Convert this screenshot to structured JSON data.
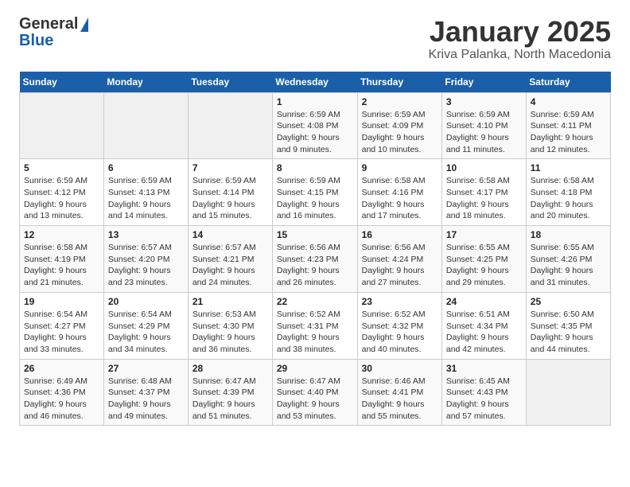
{
  "header": {
    "logo_general": "General",
    "logo_blue": "Blue",
    "month_title": "January 2025",
    "location": "Kriva Palanka, North Macedonia"
  },
  "weekdays": [
    "Sunday",
    "Monday",
    "Tuesday",
    "Wednesday",
    "Thursday",
    "Friday",
    "Saturday"
  ],
  "weeks": [
    [
      {
        "day": "",
        "sunrise": "",
        "sunset": "",
        "daylight": ""
      },
      {
        "day": "",
        "sunrise": "",
        "sunset": "",
        "daylight": ""
      },
      {
        "day": "",
        "sunrise": "",
        "sunset": "",
        "daylight": ""
      },
      {
        "day": "1",
        "sunrise": "Sunrise: 6:59 AM",
        "sunset": "Sunset: 4:08 PM",
        "daylight": "Daylight: 9 hours and 9 minutes."
      },
      {
        "day": "2",
        "sunrise": "Sunrise: 6:59 AM",
        "sunset": "Sunset: 4:09 PM",
        "daylight": "Daylight: 9 hours and 10 minutes."
      },
      {
        "day": "3",
        "sunrise": "Sunrise: 6:59 AM",
        "sunset": "Sunset: 4:10 PM",
        "daylight": "Daylight: 9 hours and 11 minutes."
      },
      {
        "day": "4",
        "sunrise": "Sunrise: 6:59 AM",
        "sunset": "Sunset: 4:11 PM",
        "daylight": "Daylight: 9 hours and 12 minutes."
      }
    ],
    [
      {
        "day": "5",
        "sunrise": "Sunrise: 6:59 AM",
        "sunset": "Sunset: 4:12 PM",
        "daylight": "Daylight: 9 hours and 13 minutes."
      },
      {
        "day": "6",
        "sunrise": "Sunrise: 6:59 AM",
        "sunset": "Sunset: 4:13 PM",
        "daylight": "Daylight: 9 hours and 14 minutes."
      },
      {
        "day": "7",
        "sunrise": "Sunrise: 6:59 AM",
        "sunset": "Sunset: 4:14 PM",
        "daylight": "Daylight: 9 hours and 15 minutes."
      },
      {
        "day": "8",
        "sunrise": "Sunrise: 6:59 AM",
        "sunset": "Sunset: 4:15 PM",
        "daylight": "Daylight: 9 hours and 16 minutes."
      },
      {
        "day": "9",
        "sunrise": "Sunrise: 6:58 AM",
        "sunset": "Sunset: 4:16 PM",
        "daylight": "Daylight: 9 hours and 17 minutes."
      },
      {
        "day": "10",
        "sunrise": "Sunrise: 6:58 AM",
        "sunset": "Sunset: 4:17 PM",
        "daylight": "Daylight: 9 hours and 18 minutes."
      },
      {
        "day": "11",
        "sunrise": "Sunrise: 6:58 AM",
        "sunset": "Sunset: 4:18 PM",
        "daylight": "Daylight: 9 hours and 20 minutes."
      }
    ],
    [
      {
        "day": "12",
        "sunrise": "Sunrise: 6:58 AM",
        "sunset": "Sunset: 4:19 PM",
        "daylight": "Daylight: 9 hours and 21 minutes."
      },
      {
        "day": "13",
        "sunrise": "Sunrise: 6:57 AM",
        "sunset": "Sunset: 4:20 PM",
        "daylight": "Daylight: 9 hours and 23 minutes."
      },
      {
        "day": "14",
        "sunrise": "Sunrise: 6:57 AM",
        "sunset": "Sunset: 4:21 PM",
        "daylight": "Daylight: 9 hours and 24 minutes."
      },
      {
        "day": "15",
        "sunrise": "Sunrise: 6:56 AM",
        "sunset": "Sunset: 4:23 PM",
        "daylight": "Daylight: 9 hours and 26 minutes."
      },
      {
        "day": "16",
        "sunrise": "Sunrise: 6:56 AM",
        "sunset": "Sunset: 4:24 PM",
        "daylight": "Daylight: 9 hours and 27 minutes."
      },
      {
        "day": "17",
        "sunrise": "Sunrise: 6:55 AM",
        "sunset": "Sunset: 4:25 PM",
        "daylight": "Daylight: 9 hours and 29 minutes."
      },
      {
        "day": "18",
        "sunrise": "Sunrise: 6:55 AM",
        "sunset": "Sunset: 4:26 PM",
        "daylight": "Daylight: 9 hours and 31 minutes."
      }
    ],
    [
      {
        "day": "19",
        "sunrise": "Sunrise: 6:54 AM",
        "sunset": "Sunset: 4:27 PM",
        "daylight": "Daylight: 9 hours and 33 minutes."
      },
      {
        "day": "20",
        "sunrise": "Sunrise: 6:54 AM",
        "sunset": "Sunset: 4:29 PM",
        "daylight": "Daylight: 9 hours and 34 minutes."
      },
      {
        "day": "21",
        "sunrise": "Sunrise: 6:53 AM",
        "sunset": "Sunset: 4:30 PM",
        "daylight": "Daylight: 9 hours and 36 minutes."
      },
      {
        "day": "22",
        "sunrise": "Sunrise: 6:52 AM",
        "sunset": "Sunset: 4:31 PM",
        "daylight": "Daylight: 9 hours and 38 minutes."
      },
      {
        "day": "23",
        "sunrise": "Sunrise: 6:52 AM",
        "sunset": "Sunset: 4:32 PM",
        "daylight": "Daylight: 9 hours and 40 minutes."
      },
      {
        "day": "24",
        "sunrise": "Sunrise: 6:51 AM",
        "sunset": "Sunset: 4:34 PM",
        "daylight": "Daylight: 9 hours and 42 minutes."
      },
      {
        "day": "25",
        "sunrise": "Sunrise: 6:50 AM",
        "sunset": "Sunset: 4:35 PM",
        "daylight": "Daylight: 9 hours and 44 minutes."
      }
    ],
    [
      {
        "day": "26",
        "sunrise": "Sunrise: 6:49 AM",
        "sunset": "Sunset: 4:36 PM",
        "daylight": "Daylight: 9 hours and 46 minutes."
      },
      {
        "day": "27",
        "sunrise": "Sunrise: 6:48 AM",
        "sunset": "Sunset: 4:37 PM",
        "daylight": "Daylight: 9 hours and 49 minutes."
      },
      {
        "day": "28",
        "sunrise": "Sunrise: 6:47 AM",
        "sunset": "Sunset: 4:39 PM",
        "daylight": "Daylight: 9 hours and 51 minutes."
      },
      {
        "day": "29",
        "sunrise": "Sunrise: 6:47 AM",
        "sunset": "Sunset: 4:40 PM",
        "daylight": "Daylight: 9 hours and 53 minutes."
      },
      {
        "day": "30",
        "sunrise": "Sunrise: 6:46 AM",
        "sunset": "Sunset: 4:41 PM",
        "daylight": "Daylight: 9 hours and 55 minutes."
      },
      {
        "day": "31",
        "sunrise": "Sunrise: 6:45 AM",
        "sunset": "Sunset: 4:43 PM",
        "daylight": "Daylight: 9 hours and 57 minutes."
      },
      {
        "day": "",
        "sunrise": "",
        "sunset": "",
        "daylight": ""
      }
    ]
  ]
}
